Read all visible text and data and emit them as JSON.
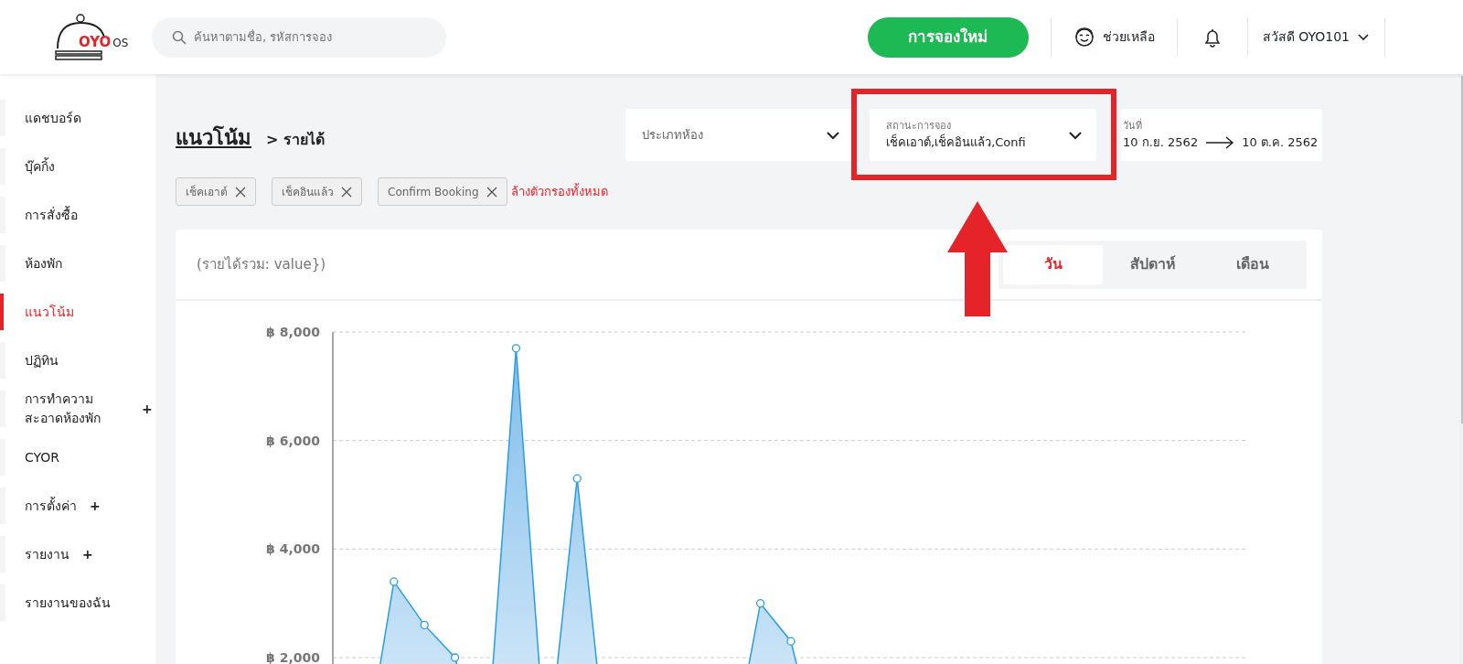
{
  "header": {
    "logo": {
      "brand": "OYO",
      "suffix": "OS"
    },
    "search": {
      "placeholder": "ค้นหาตามชื่อ, รหัสการจอง"
    },
    "new_booking_button": "การจองใหม่",
    "help": "ช่วยเหลือ",
    "user_menu": "สวัสดี OYO101"
  },
  "sidebar": {
    "items": [
      {
        "label": "แดชบอร์ด",
        "selected": false
      },
      {
        "label": "บุ๊คกิ้ง",
        "selected": false
      },
      {
        "label": "การสั่งซื้อ",
        "selected": false
      },
      {
        "label": "ห้องพัก",
        "selected": false
      },
      {
        "label": "แนวโน้ม",
        "selected": true
      },
      {
        "label": "ปฏิทิน",
        "selected": false
      },
      {
        "label": "การทำความสะอาดห้องพัก",
        "selected": false,
        "toggle": "+"
      },
      {
        "label": "CYOR",
        "selected": false
      },
      {
        "label": "การตั้งค่า",
        "selected": false,
        "toggle": "+"
      },
      {
        "label": "รายงาน",
        "selected": false,
        "toggle": "+"
      },
      {
        "label": "รายงานของฉัน",
        "selected": false
      }
    ]
  },
  "breadcrumb": {
    "title": "แนวโน้ม",
    "current": "> รายได้"
  },
  "filters": [
    {
      "kind": "select",
      "placeholder": "ประเภทห้อง",
      "highlighted": false
    },
    {
      "kind": "select",
      "label": "สถานะการจอง",
      "value": "เช็คเอาต์,เช็คอินแล้ว,Confi",
      "highlighted": true
    },
    {
      "kind": "date",
      "label": "วันที่",
      "from": "10 ก.ย. 2562",
      "to": "10 ต.ค. 2562",
      "highlighted": false
    }
  ],
  "chips": [
    "เช็คเอาต์",
    "เช็คอินแล้ว",
    "Confirm Booking"
  ],
  "clear_filters": "ล้างตัวกรองทั้งหมด",
  "card": {
    "title": "(รายได้รวม: value})",
    "tabs": [
      {
        "label": "วัน",
        "selected": true
      },
      {
        "label": "สัปดาห์",
        "selected": false
      },
      {
        "label": "เดือน",
        "selected": false
      }
    ],
    "chart_data": {
      "type": "area",
      "categories": [
        null,
        null,
        null,
        null,
        null,
        null,
        null,
        null,
        null,
        null,
        null,
        null,
        null,
        null,
        null,
        null,
        null
      ],
      "ylim": [
        0,
        8000
      ],
      "grid": true,
      "series": [
        {
          "color": "#2a9de0",
          "values": [
            0,
            0,
            3400,
            2600,
            2000,
            0,
            7700,
            0,
            5300,
            0,
            0,
            0,
            0,
            0,
            3000,
            2300,
            0
          ]
        }
      ],
      "yticks": [
        {
          "value": 2000,
          "label": "฿ 2,000"
        },
        {
          "value": 4000,
          "label": "฿ 4,000"
        },
        {
          "value": 6000,
          "label": "฿ 6,000"
        },
        {
          "value": 8000,
          "label": "฿ 8,000"
        }
      ]
    }
  }
}
